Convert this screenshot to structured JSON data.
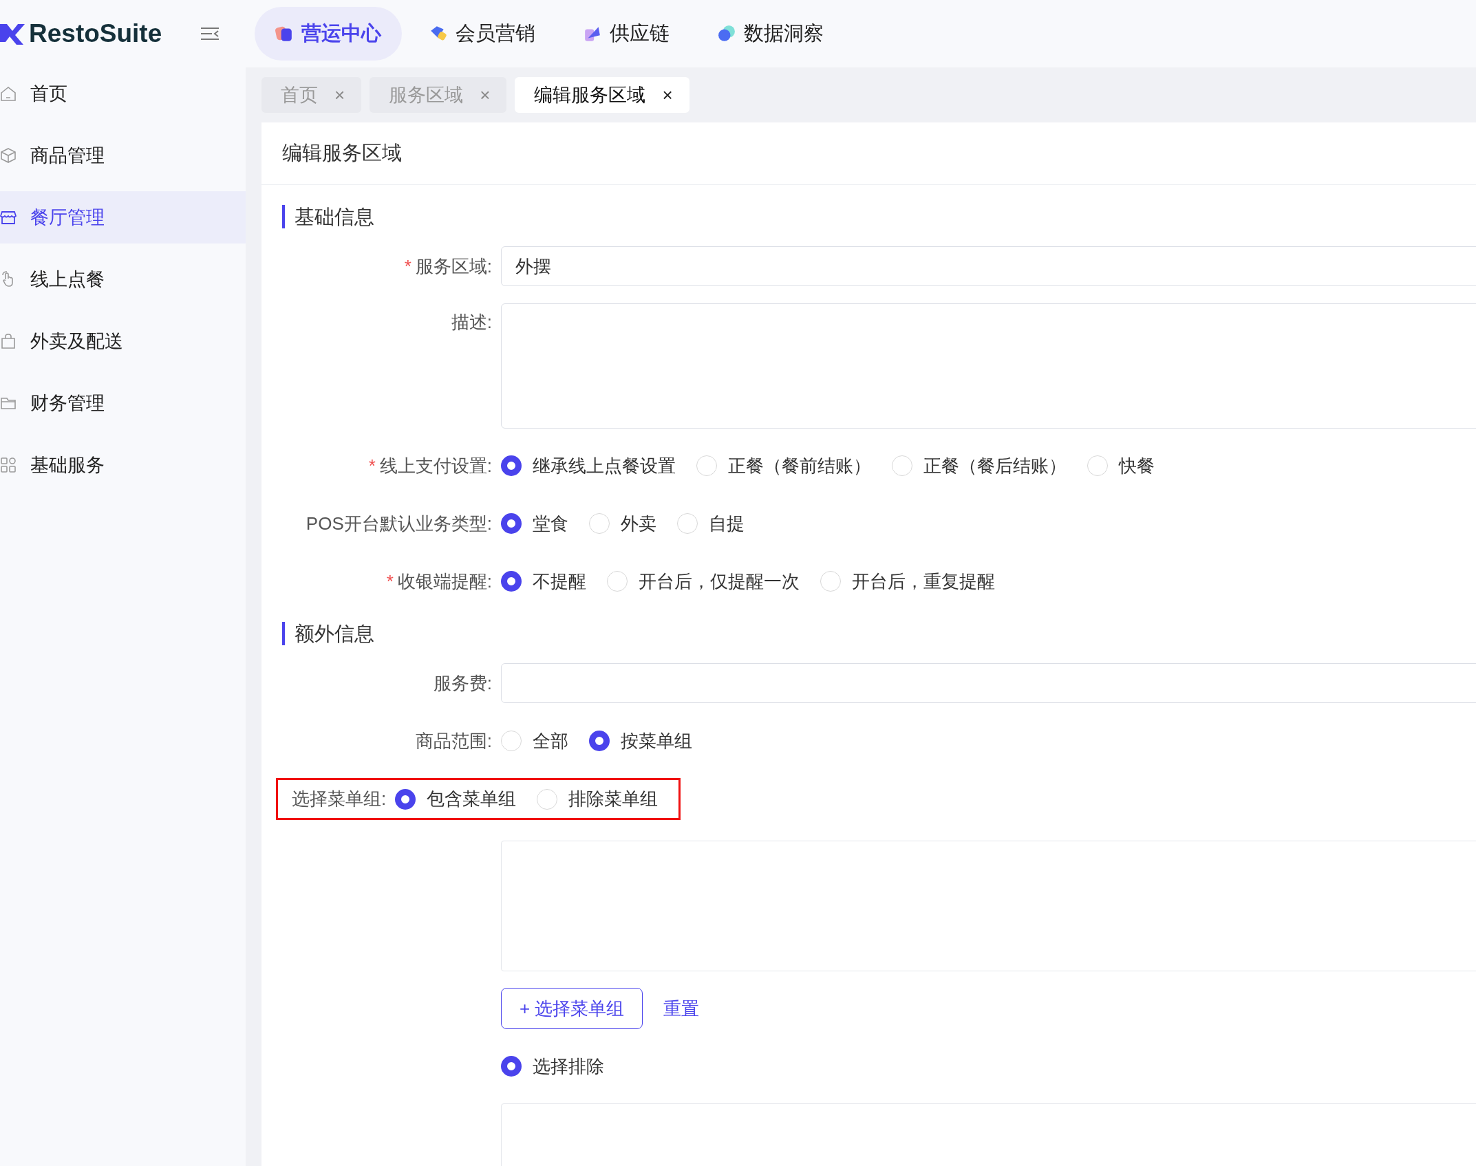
{
  "logo": {
    "text": "RestoSuite"
  },
  "top_nav": [
    {
      "label": "营运中心",
      "selected": true,
      "kind": "ops"
    },
    {
      "label": "会员营销",
      "selected": false,
      "kind": "member"
    },
    {
      "label": "供应链",
      "selected": false,
      "kind": "supply"
    },
    {
      "label": "数据洞察",
      "selected": false,
      "kind": "data"
    }
  ],
  "sidebar": {
    "items": [
      {
        "label": "首页",
        "selected": false,
        "kind": "home"
      },
      {
        "label": "商品管理",
        "selected": false,
        "kind": "product"
      },
      {
        "label": "餐厅管理",
        "selected": true,
        "kind": "shop"
      },
      {
        "label": "线上点餐",
        "selected": false,
        "kind": "hand"
      },
      {
        "label": "外卖及配送",
        "selected": false,
        "kind": "bag"
      },
      {
        "label": "财务管理",
        "selected": false,
        "kind": "folder"
      },
      {
        "label": "基础服务",
        "selected": false,
        "kind": "grid"
      }
    ]
  },
  "tabs": [
    {
      "label": "首页",
      "selected": false,
      "close": "×"
    },
    {
      "label": "服务区域",
      "selected": false,
      "close": "×"
    },
    {
      "label": "编辑服务区域",
      "selected": true,
      "close": "×"
    }
  ],
  "page_title": "编辑服务区域",
  "sections": [
    {
      "title": "基础信息",
      "fields": [
        {
          "kind": "input",
          "required_mark": "*",
          "label": "服务区域:",
          "value": "外摆"
        },
        {
          "kind": "textarea",
          "label": "描述:"
        },
        {
          "kind": "radio",
          "required_mark": "*",
          "label": "线上支付设置:",
          "options": [
            {
              "label": "继承线上点餐设置",
              "selected": true
            },
            {
              "label": "正餐（餐前结账）",
              "selected": false
            },
            {
              "label": "正餐（餐后结账）",
              "selected": false
            },
            {
              "label": "快餐",
              "selected": false
            }
          ]
        },
        {
          "kind": "radio",
          "label": "POS开台默认业务类型:",
          "options": [
            {
              "label": "堂食",
              "selected": true
            },
            {
              "label": "外卖",
              "selected": false
            },
            {
              "label": "自提",
              "selected": false
            }
          ]
        },
        {
          "kind": "radio",
          "required_mark": "*",
          "label": "收银端提醒:",
          "options": [
            {
              "label": "不提醒",
              "selected": true
            },
            {
              "label": "开台后，仅提醒一次",
              "selected": false
            },
            {
              "label": "开台后，重复提醒",
              "selected": false
            }
          ]
        }
      ]
    },
    {
      "title": "额外信息",
      "fields": [
        {
          "kind": "input",
          "label": "服务费:"
        },
        {
          "kind": "radio",
          "label": "商品范围:",
          "options": [
            {
              "label": "全部",
              "selected": false
            },
            {
              "label": "按菜单组",
              "selected": true
            }
          ]
        },
        {
          "kind": "radio",
          "label": "选择菜单组:",
          "highlighted": true,
          "options": [
            {
              "label": "包含菜单组",
              "selected": true
            },
            {
              "label": "排除菜单组",
              "selected": false
            }
          ]
        },
        {
          "kind": "panel"
        },
        {
          "kind": "actions",
          "button": "+ 选择菜单组",
          "link": "重置"
        },
        {
          "kind": "radio",
          "options": [
            {
              "label": "选择排除",
              "selected": true
            }
          ]
        },
        {
          "kind": "panel"
        }
      ]
    }
  ]
}
